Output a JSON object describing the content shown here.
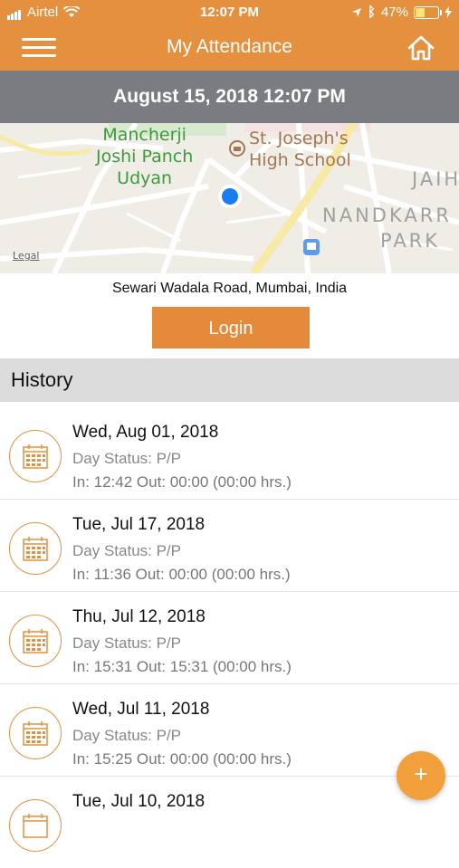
{
  "status_bar": {
    "carrier": "Airtel",
    "time": "12:07 PM",
    "battery_percent": "47%",
    "battery_level": 0.47
  },
  "nav": {
    "title": "My Attendance",
    "menu_icon": "hamburger-icon",
    "home_icon": "home-icon"
  },
  "current_datetime": "August 15, 2018 12:07 PM",
  "map": {
    "park_label_lines": [
      "Mancherji",
      "Joshi Panch",
      "Udyan"
    ],
    "school_label_lines": [
      "St. Joseph's",
      "High School"
    ],
    "area_labels": [
      "JAIH",
      "NANDKARR",
      "PARK"
    ],
    "legal": "Legal"
  },
  "address": "Sewari Wadala Road, Mumbai, India",
  "login_label": "Login",
  "history": {
    "title": "History",
    "items": [
      {
        "date": "Wed, Aug 01, 2018",
        "status": "Day Status: P/P",
        "io": "In: 12:42 Out: 00:00 (00:00 hrs.)"
      },
      {
        "date": "Tue, Jul 17, 2018",
        "status": "Day Status: P/P",
        "io": "In: 11:36 Out: 00:00 (00:00 hrs.)"
      },
      {
        "date": "Thu, Jul 12, 2018",
        "status": "Day Status: P/P",
        "io": "In: 15:31 Out: 15:31 (00:00 hrs.)"
      },
      {
        "date": "Wed, Jul 11, 2018",
        "status": "Day Status: P/P",
        "io": "In: 15:25 Out: 00:00 (00:00 hrs.)"
      },
      {
        "date": "Tue, Jul 10, 2018",
        "status": "",
        "io": ""
      }
    ]
  },
  "fab_label": "+",
  "colors": {
    "accent": "#e5903e",
    "date_bar": "#7b7c81",
    "history_header": "#dcdcdc",
    "location_dot": "#1a7cf0"
  }
}
